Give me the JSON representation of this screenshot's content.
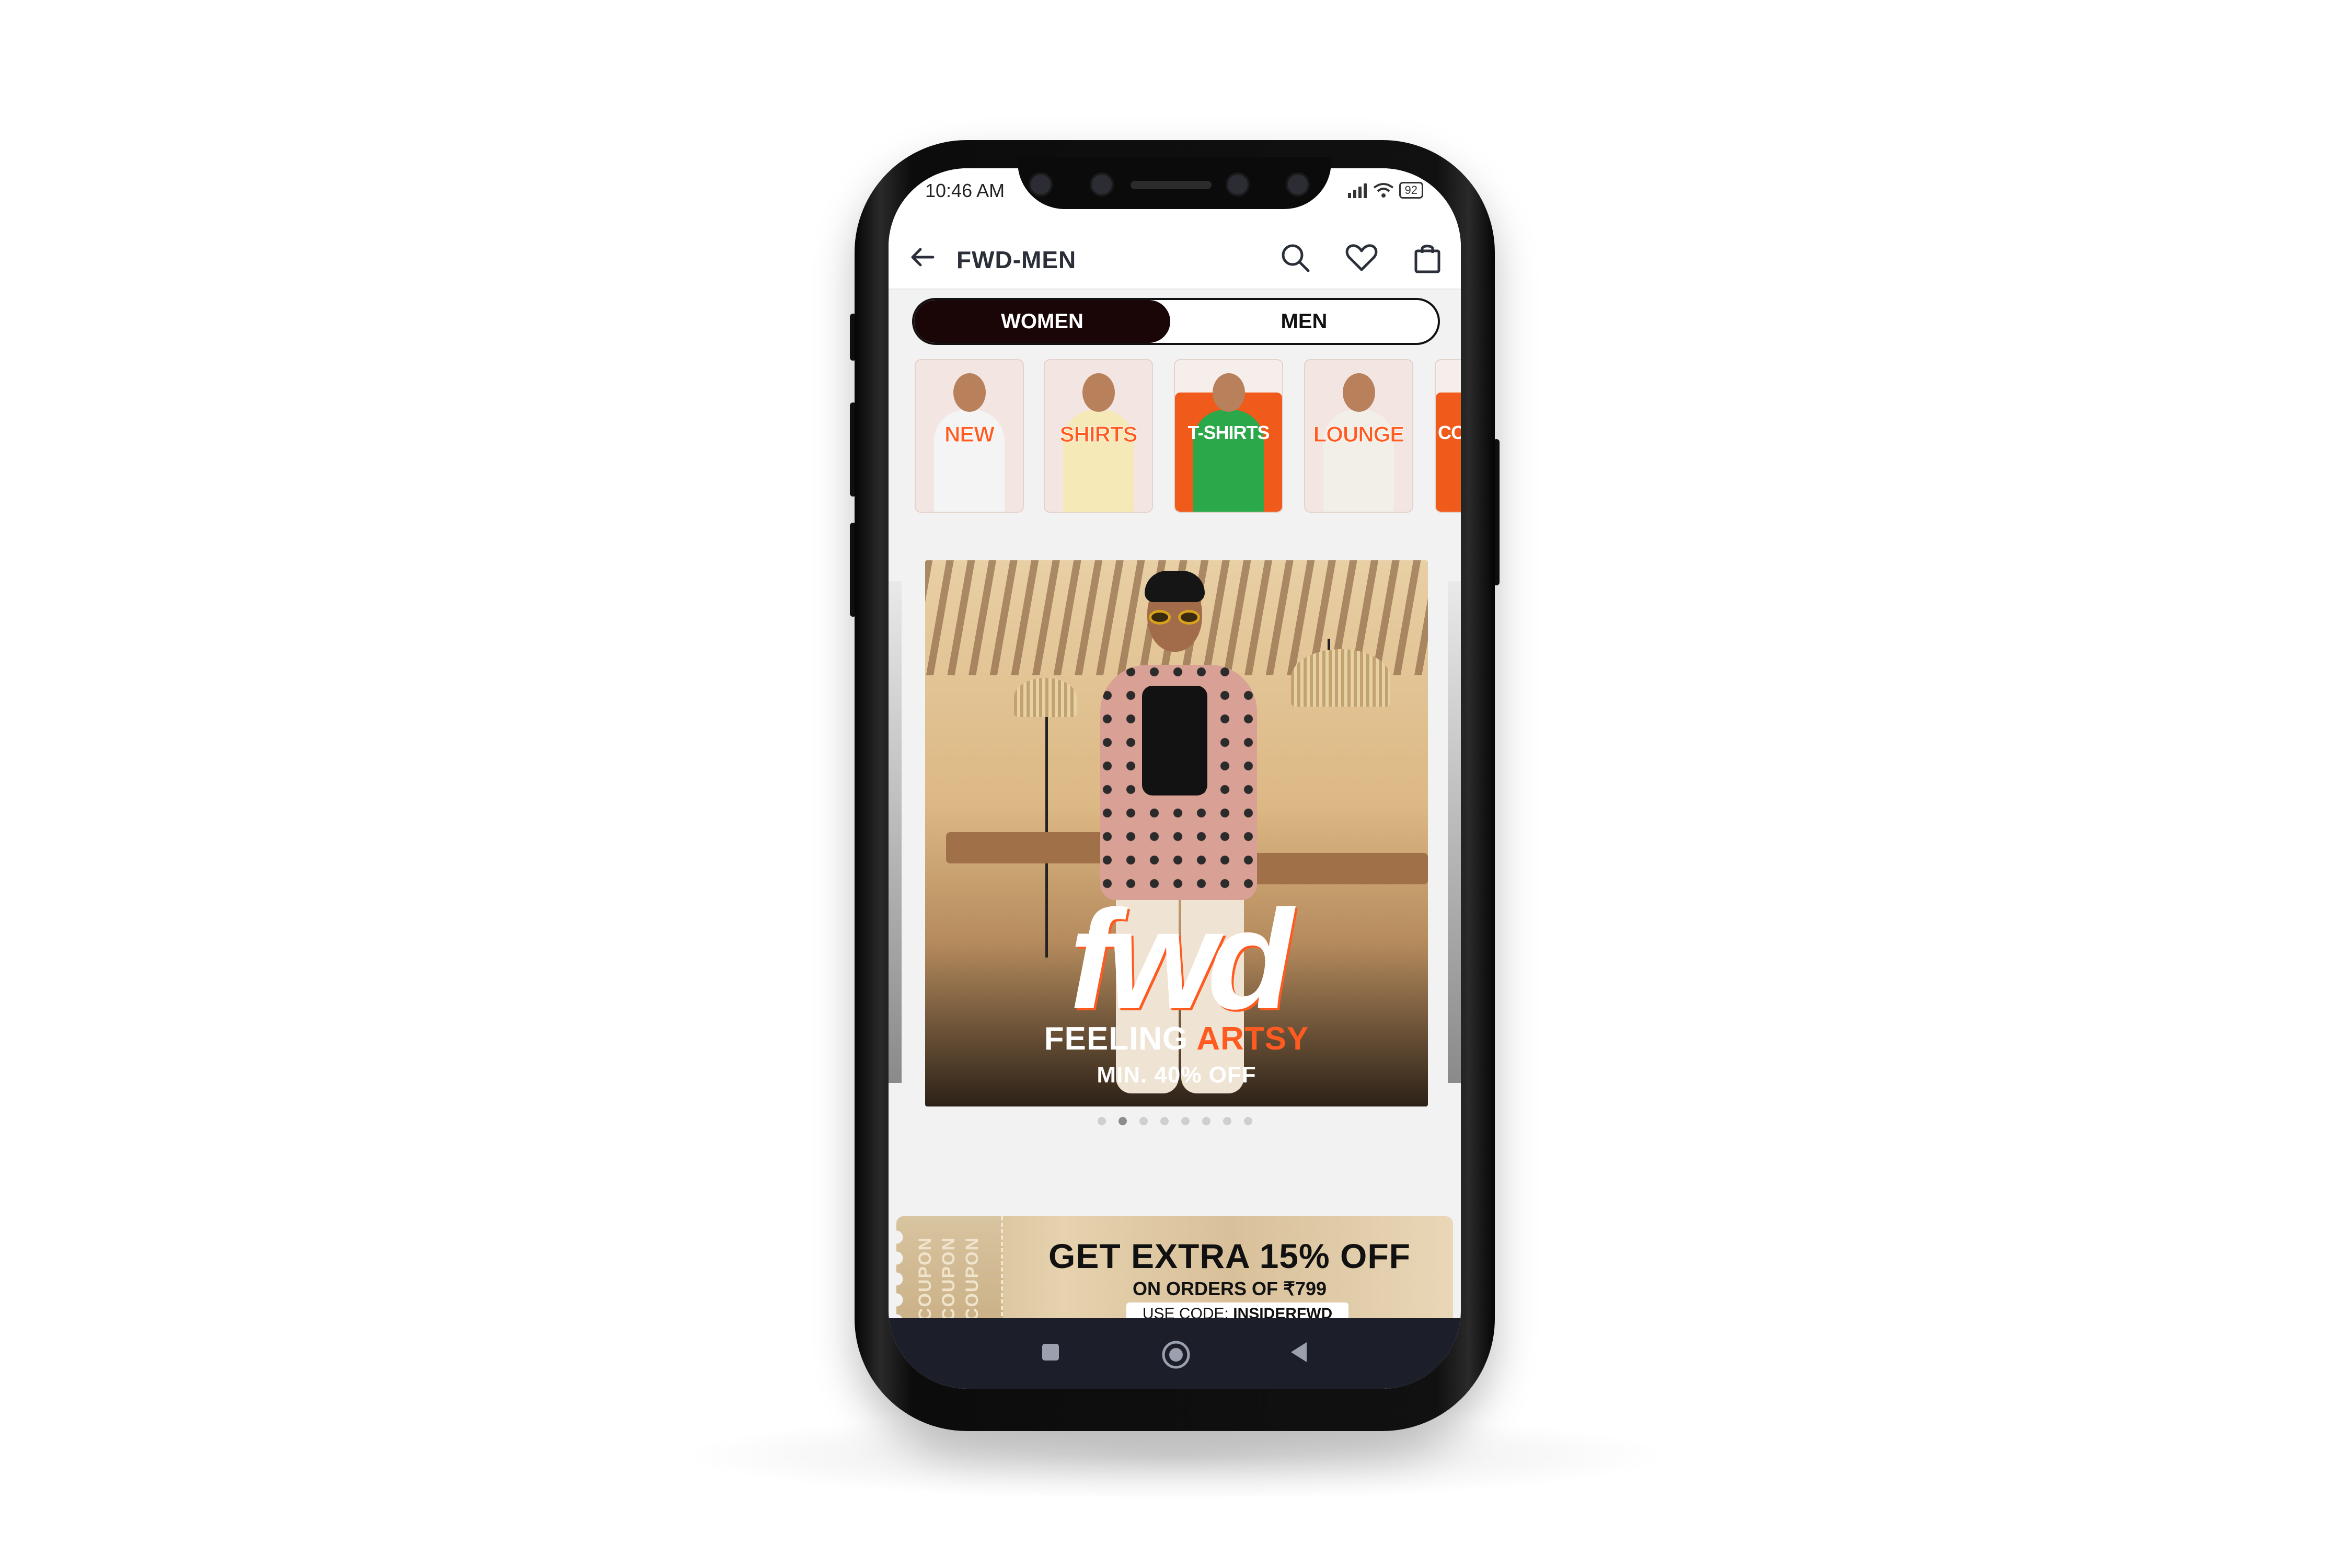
{
  "status_bar": {
    "time": "10:46 AM",
    "battery": "92"
  },
  "header": {
    "title": "FWD-MEN"
  },
  "icons": {
    "back": "arrow-left-icon",
    "search": "search-icon",
    "wishlist": "heart-icon",
    "bag": "shopping-bag-icon",
    "nav_recent": "square-icon",
    "nav_home": "circle-icon",
    "nav_back": "triangle-left-icon"
  },
  "toggle": {
    "women": "WOMEN",
    "men": "MEN",
    "active": "WOMEN"
  },
  "categories": [
    {
      "label": "NEW"
    },
    {
      "label": "SHIRTS"
    },
    {
      "label": "T-SHIRTS"
    },
    {
      "label": "LOUNGE"
    },
    {
      "label": "CO"
    }
  ],
  "banner": {
    "brand": "fwd",
    "tagline_a": "FEELING",
    "tagline_b": "ARTSY",
    "offer": "MIN. 40% OFF"
  },
  "carousel": {
    "total": 8,
    "active_index": 1
  },
  "coupon": {
    "stub_text": "COUPON",
    "title": "GET EXTRA 15% OFF",
    "subtitle": "ON ORDERS OF ₹799",
    "code_label": "USE CODE:",
    "code": "INSIDERFWD"
  },
  "colors": {
    "accent": "#ff5a1f",
    "toggle_active": "#1a0606",
    "nav_bar": "#1c1f2a"
  }
}
